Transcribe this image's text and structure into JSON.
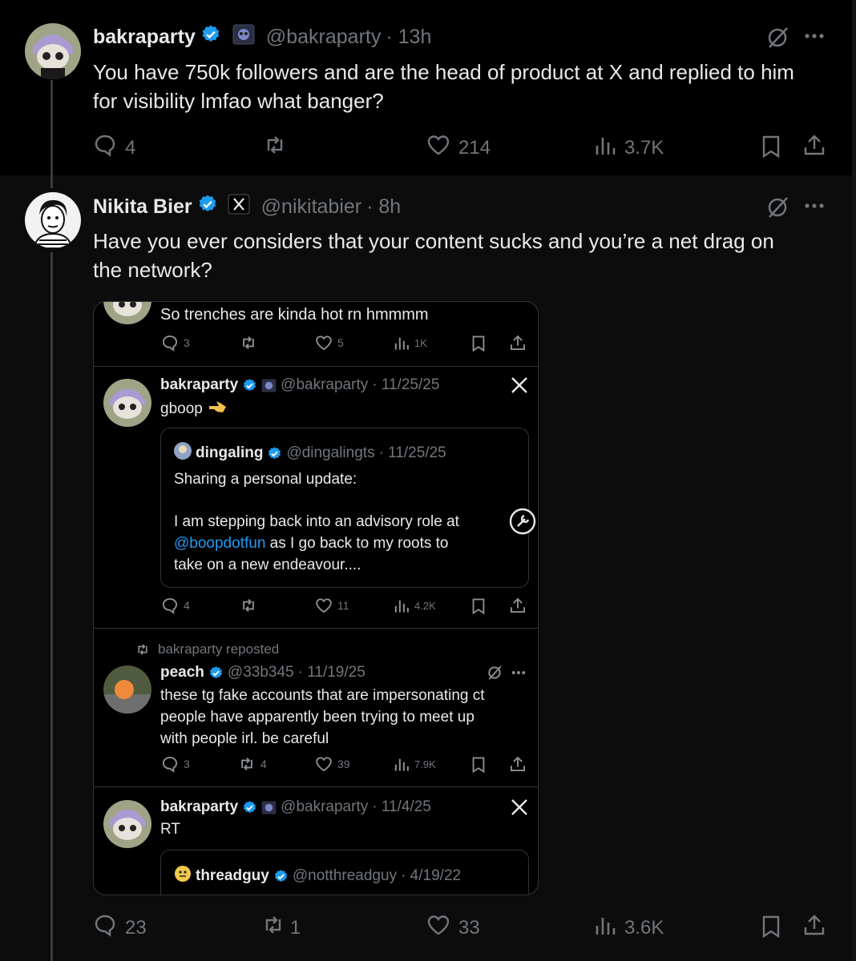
{
  "tweet1": {
    "name": "bakraparty",
    "handle": "@bakraparty",
    "time": "· 13h",
    "text_line1": "You have 750k followers and are the head of product at X and replied to him",
    "text_line2": "for visibility lmfao what banger?",
    "replies": "4",
    "likes": "214",
    "views": "3.7K"
  },
  "tweet2": {
    "name": "Nikita Bier",
    "handle": "@nikitabier",
    "time": "· 8h",
    "text_line1": "Have you ever considers that your content sucks and you’re a net drag on",
    "text_line2": "the network?",
    "replies": "23",
    "reposts": "1",
    "likes": "33",
    "views": "3.6K"
  },
  "screenshot": {
    "post_a": {
      "text": "So trenches are kinda hot rn hmmmm",
      "replies": "3",
      "likes": "5",
      "views": "1K"
    },
    "post_b": {
      "name": "bakraparty",
      "handle": "@bakraparty",
      "date": "· 11/25/25",
      "text": "gboop",
      "quote": {
        "name": "dingaling",
        "handle": "@dingalingts",
        "date": "· 11/25/25",
        "line1": "Sharing a personal update:",
        "line2": "I am stepping back into an advisory role at",
        "mention": "@boopdotfun",
        "line3_rest": " as I go back to my roots to",
        "line4": "take on a new endeavour...."
      },
      "replies": "4",
      "likes": "11",
      "views": "4.2K"
    },
    "post_c": {
      "reposted_by": "bakraparty reposted",
      "name": "peach",
      "handle": "@33b345",
      "date": "· 11/19/25",
      "line1": "these tg fake accounts that are impersonating ct",
      "line2": "people have apparently been trying to meet up",
      "line3": "with people irl. be careful",
      "replies": "3",
      "reposts": "4",
      "likes": "39",
      "views": "7.9K"
    },
    "post_d": {
      "name": "bakraparty",
      "handle": "@bakraparty",
      "date": "· 11/4/25",
      "text": "RT",
      "quote": {
        "name": "threadguy",
        "handle": "@notthreadguy",
        "date": "· 4/19/22"
      }
    }
  },
  "colors": {
    "verified": "#1d9bf0",
    "link": "#1d9bf0",
    "muted": "#71767b",
    "text": "#e7e9ea"
  }
}
